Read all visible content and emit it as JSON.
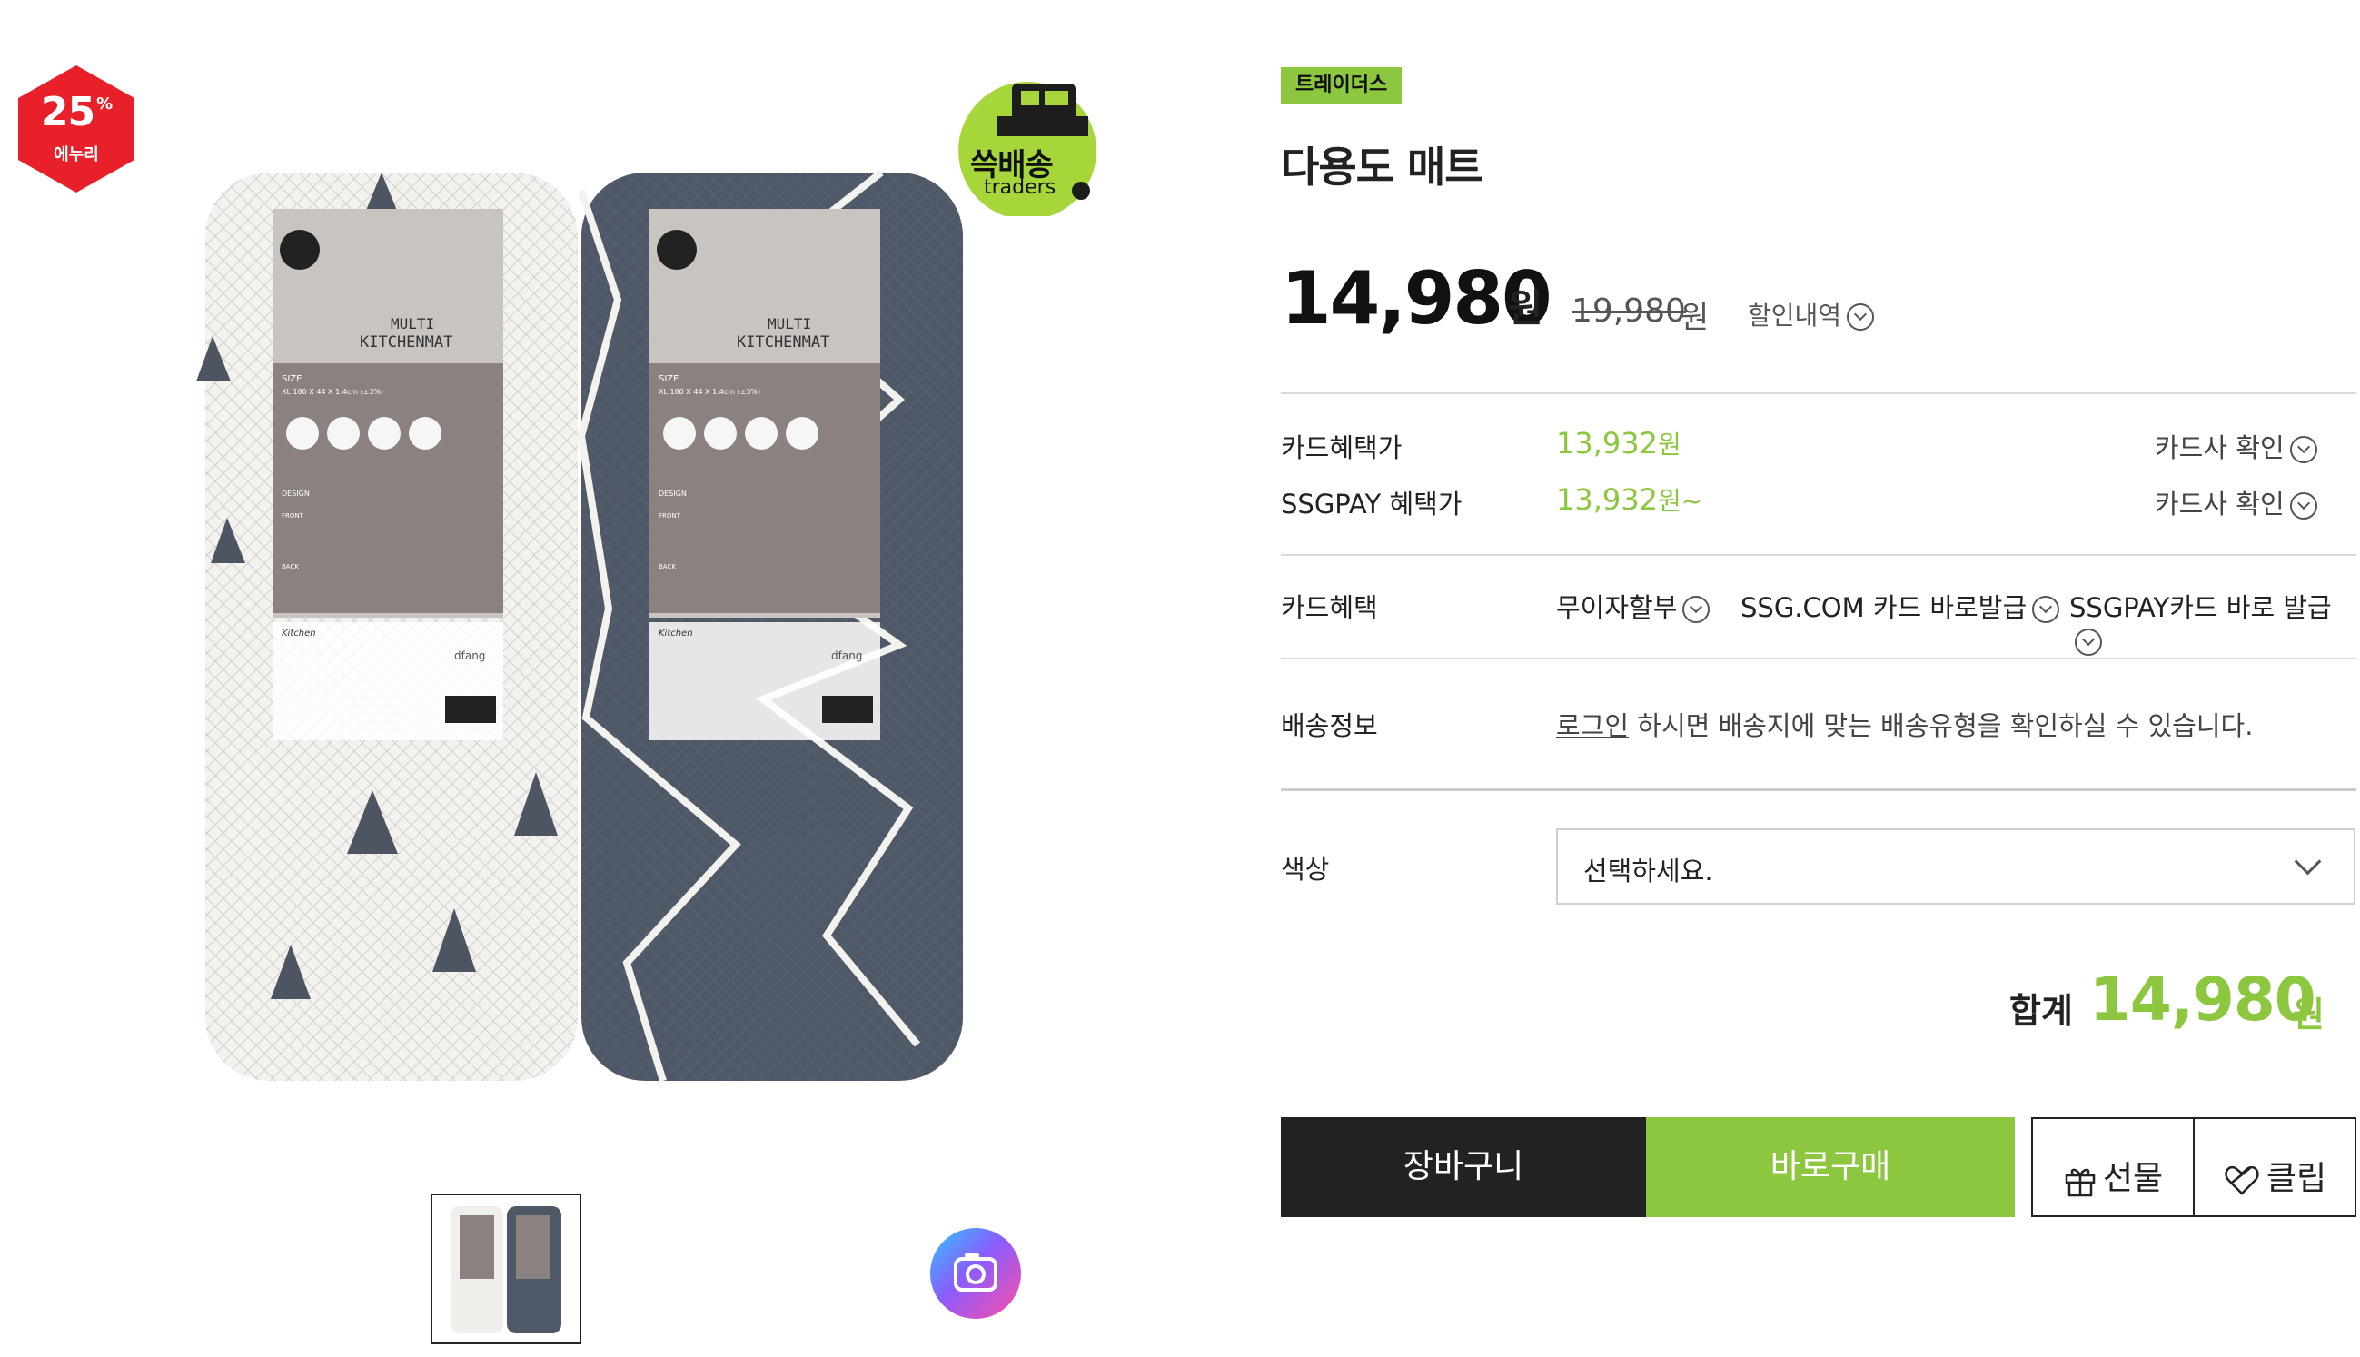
{
  "badge": {
    "percent": "25",
    "percent_sign": "%",
    "label": "에누리"
  },
  "delivery_badge": {
    "word": "쓱배송",
    "brand": "traders"
  },
  "product_image": {
    "left_roll": {
      "brand": "Kitchen",
      "title_top": "MULTI",
      "title": "KITCHENMAT",
      "size_label": "SIZE",
      "size_text": "XL 180 X 44 X 1.4cm (±3%)",
      "design": "DESIGN",
      "front": "FRONT",
      "back": "BACK",
      "logo": "dfang"
    },
    "right_roll": {
      "brand": "Kitchen",
      "title_top": "MULTI",
      "title": "KITCHENMAT",
      "size_label": "SIZE",
      "size_text": "XL 180 X 44 X 1.4cm (±3%)",
      "design": "DESIGN",
      "front": "FRONT",
      "back": "BACK",
      "logo": "dfang"
    }
  },
  "store_tag": "트레이더스",
  "product_title": "다용도 매트",
  "price": {
    "sale": "14,980",
    "sale_unit": "원",
    "original": "19,980",
    "original_unit": "원",
    "discount_link": "할인내역"
  },
  "benefits": {
    "card_price_label": "카드혜택가",
    "card_price_value": "13,932",
    "card_price_unit": "원",
    "card_check_link": "카드사 확인",
    "ssgpay_label": "SSGPAY 혜택가",
    "ssgpay_value": "13,932",
    "ssgpay_unit": "원~",
    "ssgpay_check_link": "카드사 확인"
  },
  "card_benefit": {
    "label": "카드혜택",
    "links": [
      "무이자할부",
      "SSG.COM 카드 바로발급",
      "SSGPAY카드 바로 발급"
    ]
  },
  "shipping": {
    "label": "배송정보",
    "login_link": "로그인",
    "message": " 하시면 배송지에 맞는 배송유형을 확인하실 수 있습니다."
  },
  "color_option": {
    "label": "색상",
    "placeholder": "선택하세요."
  },
  "total": {
    "label": "합계",
    "value": "14,980",
    "unit": "원"
  },
  "buttons": {
    "cart": "장바구니",
    "buy": "바로구매",
    "gift": "선물",
    "clip": "클립"
  },
  "colors": {
    "accent_green": "#8dc63f",
    "badge_red": "#e8202a",
    "dark": "#222222"
  }
}
